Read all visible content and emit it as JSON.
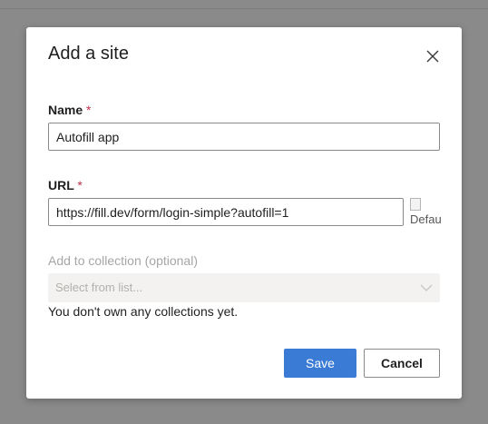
{
  "dialog": {
    "title": "Add a site",
    "close_icon": "close-icon"
  },
  "name_field": {
    "label": "Name",
    "required_mark": "*",
    "value": "Autofill app"
  },
  "url_field": {
    "label": "URL",
    "required_mark": "*",
    "value": "https://fill.dev/form/login-simple?autofill=1",
    "favicon_alt": "Default"
  },
  "collection_field": {
    "label": "Add to collection (optional)",
    "placeholder": "Select from list...",
    "note": "You don't own any collections yet.",
    "chevron_icon": "chevron-down-icon"
  },
  "actions": {
    "save_label": "Save",
    "cancel_label": "Cancel"
  },
  "colors": {
    "primary": "#3a7bd5",
    "required": "#c4314b",
    "backdrop": "#8a8a8a"
  }
}
